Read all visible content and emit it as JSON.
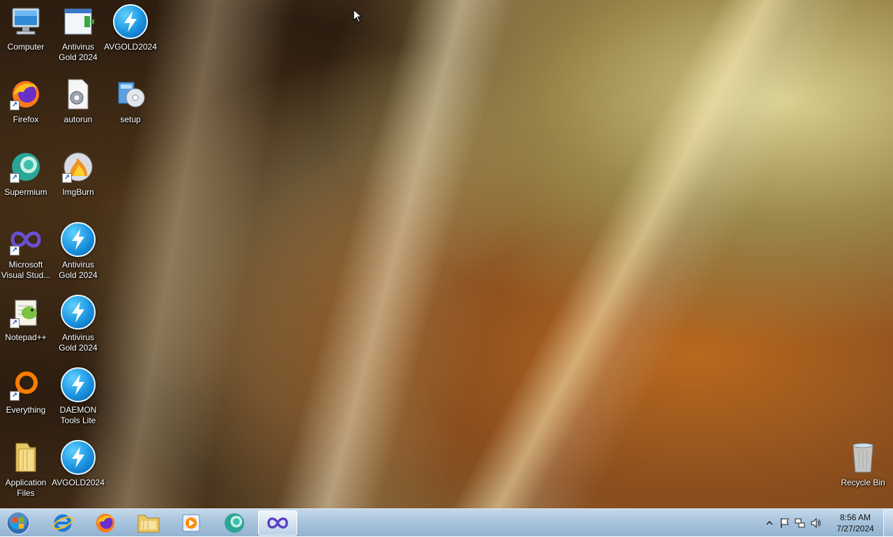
{
  "desktop": {
    "icons": [
      {
        "label": "Computer",
        "icon": "computer-icon"
      },
      {
        "label": "Antivirus\nGold 2024",
        "icon": "window-app-icon"
      },
      {
        "label": "AVGOLD2024",
        "icon": "lightning-icon"
      },
      {
        "label": "Firefox",
        "icon": "firefox-icon",
        "shortcut": true
      },
      {
        "label": "autorun",
        "icon": "gear-file-icon"
      },
      {
        "label": "setup",
        "icon": "setup-disc-icon"
      },
      {
        "label": "Supermium",
        "icon": "supermium-icon",
        "shortcut": true
      },
      {
        "label": "ImgBurn",
        "icon": "disc-fire-icon",
        "shortcut": true
      },
      {
        "label": "Microsoft\nVisual Stud...",
        "icon": "visual-studio-icon",
        "shortcut": true
      },
      {
        "label": "Antivirus\nGold 2024",
        "icon": "lightning-icon"
      },
      {
        "label": "Notepad++",
        "icon": "notepad-plus-icon",
        "shortcut": true
      },
      {
        "label": "Antivirus\nGold 2024",
        "icon": "lightning-icon"
      },
      {
        "label": "Everything",
        "icon": "magnifier-ring-icon",
        "shortcut": true
      },
      {
        "label": "DAEMON\nTools Lite",
        "icon": "lightning-icon"
      },
      {
        "label": "Application\nFiles",
        "icon": "folder-icon"
      },
      {
        "label": "AVGOLD2024",
        "icon": "lightning-icon"
      },
      {
        "label": "Recycle Bin",
        "icon": "recycle-bin-icon"
      }
    ]
  },
  "taskbar": {
    "start": {
      "icon": "windows-start-icon"
    },
    "pinned": [
      {
        "name": "Internet Explorer",
        "icon": "internet-explorer-icon"
      },
      {
        "name": "Firefox",
        "icon": "firefox-icon"
      },
      {
        "name": "Windows Explorer",
        "icon": "folder-explorer-icon"
      },
      {
        "name": "Media Player",
        "icon": "media-player-icon"
      },
      {
        "name": "Supermium",
        "icon": "supermium-icon"
      },
      {
        "name": "Visual Studio",
        "icon": "visual-studio-icon",
        "active": true
      }
    ],
    "tray": {
      "icons": [
        "show-hidden-icons-arrow",
        "action-center-flag-icon",
        "network-icon",
        "volume-icon"
      ],
      "time": "8:56 AM",
      "date": "7/27/2024"
    }
  },
  "colors": {
    "taskbar": "#a9c4dd",
    "accent": "#1a93e0"
  }
}
